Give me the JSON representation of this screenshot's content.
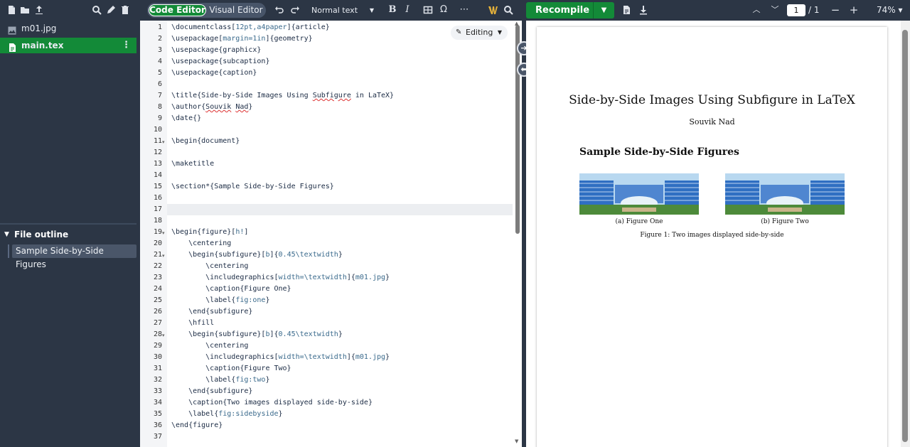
{
  "toolbar": {
    "left_icons": [
      "new-file-icon",
      "new-folder-icon",
      "upload-icon",
      "search-icon",
      "rename-icon",
      "delete-icon"
    ],
    "mode": {
      "code_editor": "Code Editor",
      "visual_editor": "Visual Editor",
      "active": "Code Editor"
    },
    "text_style": "Normal text",
    "format_icons": [
      "bold-icon",
      "italic-icon",
      "table-icon",
      "omega-icon",
      "more-icon"
    ],
    "recompile_label": "Recompile",
    "page_current": "1",
    "page_total": "/ 1",
    "zoom": "74%",
    "accent": "#138a38"
  },
  "sidebar": {
    "files": [
      {
        "name": "m01.jpg",
        "icon": "image-icon",
        "selected": false
      },
      {
        "name": "main.tex",
        "icon": "file-icon",
        "selected": true
      }
    ],
    "outline_title": "File outline",
    "outline_items": [
      "Sample Side-by-Side Figures"
    ]
  },
  "editor": {
    "mode_label": "Editing",
    "active_line": 17,
    "lines": [
      "\\documentclass[12pt,a4paper]{article}",
      "\\usepackage[margin=1in]{geometry}",
      "\\usepackage{graphicx}",
      "\\usepackage{subcaption}",
      "\\usepackage{caption}",
      "",
      "\\title{Side-by-Side Images Using Subfigure in LaTeX}",
      "\\author{Souvik Nad}",
      "\\date{}",
      "",
      "\\begin{document}",
      "",
      "\\maketitle",
      "",
      "\\section*{Sample Side-by-Side Figures}",
      "",
      "",
      "",
      "\\begin{figure}[h!]",
      "    \\centering",
      "    \\begin{subfigure}[b]{0.45\\textwidth}",
      "        \\centering",
      "        \\includegraphics[width=\\textwidth]{m01.jpg}",
      "        \\caption{Figure One}",
      "        \\label{fig:one}",
      "    \\end{subfigure}",
      "    \\hfill",
      "    \\begin{subfigure}[b]{0.45\\textwidth}",
      "        \\centering",
      "        \\includegraphics[width=\\textwidth]{m01.jpg}",
      "        \\caption{Figure Two}",
      "        \\label{fig:two}",
      "    \\end{subfigure}",
      "    \\caption{Two images displayed side-by-side}",
      "    \\label{fig:sidebyside}",
      "\\end{figure}",
      ""
    ],
    "fold_lines": [
      11,
      19,
      21,
      28
    ]
  },
  "pdf": {
    "title": "Side-by-Side Images Using Subfigure in LaTeX",
    "author": "Souvik Nad",
    "section": "Sample Side-by-Side Figures",
    "caption_a": "(a) Figure One",
    "caption_b": "(b) Figure Two",
    "figure_caption": "Figure 1: Two images displayed side-by-side"
  }
}
